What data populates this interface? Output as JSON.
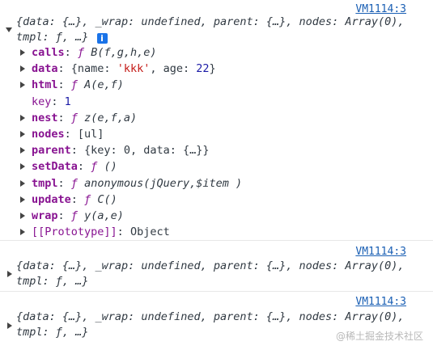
{
  "entries": [
    {
      "source": "VM1114:3",
      "summary_line1": "{data: {…}, _wrap: undefined, parent: {…}, nodes: Array(0),",
      "summary_line2": "tmpl: ƒ, …}",
      "info_icon": "i",
      "properties": [
        {
          "key": "calls",
          "value_prefix": "ƒ",
          "value": "B(f,g,h,e)",
          "type": "function"
        },
        {
          "key": "data",
          "value": "{name: 'kkk', age: 22}",
          "type": "object"
        },
        {
          "key": "html",
          "value_prefix": "ƒ",
          "value": "A(e,f)",
          "type": "function"
        },
        {
          "key": "key",
          "value": "1",
          "type": "number"
        },
        {
          "key": "nest",
          "value_prefix": "ƒ",
          "value": "z(e,f,a)",
          "type": "function"
        },
        {
          "key": "nodes",
          "value": "[ul]",
          "type": "object"
        },
        {
          "key": "parent",
          "value": "{key: 0, data: {…}}",
          "type": "object"
        },
        {
          "key": "setData",
          "value_prefix": "ƒ",
          "value": "()",
          "type": "function"
        },
        {
          "key": "tmpl",
          "value_prefix": "ƒ",
          "value": "anonymous(jQuery,$item )",
          "type": "function"
        },
        {
          "key": "update",
          "value_prefix": "ƒ",
          "value": "C()",
          "type": "function"
        },
        {
          "key": "wrap",
          "value_prefix": "ƒ",
          "value": "y(a,e)",
          "type": "function"
        },
        {
          "key": "[[Prototype]]",
          "value": "Object",
          "type": "object"
        }
      ]
    },
    {
      "source": "VM1114:3",
      "summary_line1": "{data: {…}, _wrap: undefined, parent: {…}, nodes: Array(0),",
      "summary_line2": "tmpl: ƒ, …}"
    },
    {
      "source": "VM1114:3",
      "summary_line1": "{data: {…}, _wrap: undefined, parent: {…}, nodes: Array(0),",
      "summary_line2": "tmpl: ƒ, …}"
    }
  ],
  "watermark": "@稀土掘金技术社区"
}
